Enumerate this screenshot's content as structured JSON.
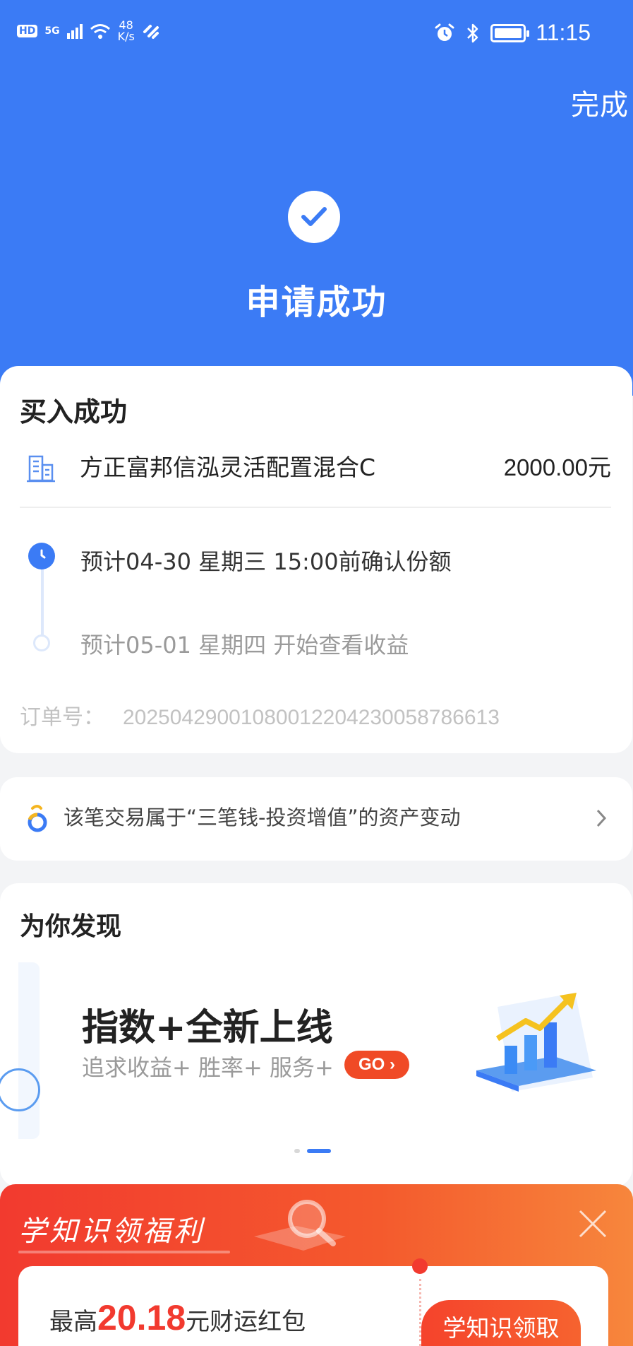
{
  "status_bar": {
    "network_hd": "HD",
    "network_type": "5G",
    "speed_value": "48",
    "speed_unit": "K/s",
    "time": "11:15"
  },
  "header": {
    "done_label": "完成",
    "result_title": "申请成功"
  },
  "purchase": {
    "title": "买入成功",
    "fund_name": "方正富邦信泓灵活配置混合C",
    "amount": "2000.00元",
    "timeline": [
      {
        "text": "预计04-30 星期三 15:00前确认份额"
      },
      {
        "text": "预计05-01 星期四 开始查看收益"
      }
    ],
    "order_label": "订单号：",
    "order_number": "202504290010800122042300587866​13"
  },
  "asset_link": {
    "text": "该笔交易属于“三笔钱-投资增值”的资产变动"
  },
  "discover": {
    "title": "为你发现",
    "banner_title": "指数+全新上线",
    "banner_subtitle": "追求收益+ 胜率+ 服务+",
    "banner_button": "GO",
    "active_page": 2,
    "page_count": 2
  },
  "promo": {
    "title": "学知识领福利",
    "text_prefix": "最高",
    "amount": "20.18",
    "text_suffix": "元财运红包",
    "button_label": "学知识领取"
  },
  "colors": {
    "primary_blue": "#3b7bf5",
    "promo_red": "#f23a2f",
    "go_orange": "#f04a26"
  }
}
